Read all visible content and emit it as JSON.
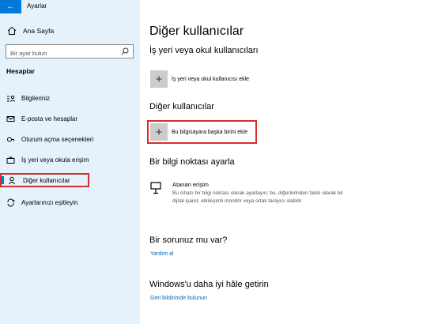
{
  "app": {
    "title": "Ayarlar",
    "back_glyph": "←"
  },
  "sidebar": {
    "home_label": "Ana Sayfa",
    "search_placeholder": "Bir ayar bulun",
    "section": "Hesaplar",
    "items": [
      {
        "label": "Bilgileriniz",
        "icon": "person-card-icon"
      },
      {
        "label": "E-posta ve hesaplar",
        "icon": "mail-icon"
      },
      {
        "label": "Oturum açma seçenekleri",
        "icon": "key-icon"
      },
      {
        "label": "İş yeri veya okula erişim",
        "icon": "briefcase-icon"
      },
      {
        "label": "Diğer kullanıcılar",
        "icon": "person-icon",
        "active": true
      },
      {
        "label": "Ayarlarınızı eşitleyin",
        "icon": "sync-icon"
      }
    ]
  },
  "main": {
    "title": "Diğer kullanıcılar",
    "work_section": "İş yeri veya okul kullanıcıları",
    "work_add_label": "İş yeri veya okul kullanıcısı ekle",
    "other_section": "Diğer kullanıcılar",
    "other_add_label": "Bu bilgisayara başka birini ekle",
    "kiosk_section": "Bir bilgi noktası ayarla",
    "kiosk_title": "Atanan erişim",
    "kiosk_desc": "Bu cihazı bir bilgi noktası olarak ayarlayın; bu, diğerlerinden farklı olarak bir dijital işaret, etkileşimli monitör veya ortak tarayıcı olabilir.",
    "question_section": "Bir sorunuz mu var?",
    "help_link": "Yardım al",
    "improve_section": "Windows'u daha iyi hâle getirin",
    "feedback_link": "Geri bildirimde bulunun",
    "plus_glyph": "+"
  },
  "colors": {
    "accent": "#0078d7",
    "highlight": "#d32f2f",
    "sidebar_bg": "#e6f2fb",
    "link": "#0067b8"
  }
}
